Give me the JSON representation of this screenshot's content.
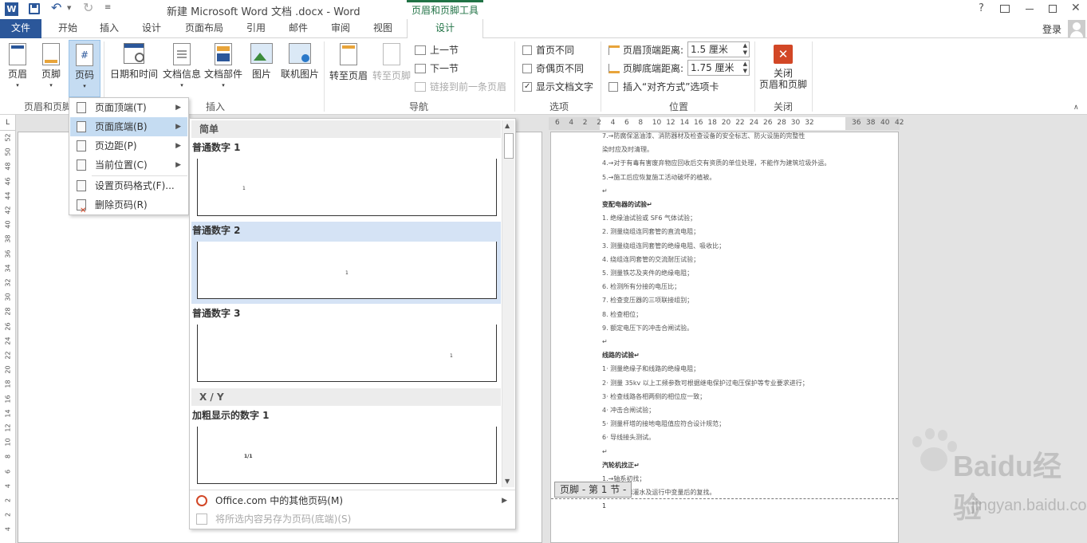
{
  "window": {
    "title": "新建 Microsoft Word 文档 .docx - Word",
    "context_tab": "页眉和页脚工具",
    "help": "?",
    "signin": "登录"
  },
  "tabs": [
    "文件",
    "开始",
    "插入",
    "设计",
    "页面布局",
    "引用",
    "邮件",
    "审阅",
    "视图",
    "设计"
  ],
  "ribbon": {
    "hf_group": {
      "header": "页眉",
      "footer": "页脚",
      "pagenum": "页码",
      "label": "页眉和页脚"
    },
    "insert_group": {
      "datetime": "日期和时间",
      "docinfo": "文档信息",
      "parts": "文档部件",
      "picture": "图片",
      "online": "联机图片",
      "label": "插入"
    },
    "nav_group": {
      "goto_header": "转至页眉",
      "goto_footer": "转至页脚",
      "prev": "上一节",
      "next": "下一节",
      "link": "链接到前一条页眉",
      "label": "导航"
    },
    "options_group": {
      "first": "首页不同",
      "oddeven": "奇偶页不同",
      "showtext": "显示文档文字",
      "label": "选项"
    },
    "position_group": {
      "header_dist_label": "页眉顶端距离:",
      "header_dist": "1.5 厘米",
      "footer_dist_label": "页脚底端距离:",
      "footer_dist": "1.75 厘米",
      "align_tab": "插入“对齐方式”选项卡",
      "label": "位置"
    },
    "close_group": {
      "close_l1": "关闭",
      "close_l2": "页眉和页脚",
      "label": "关闭"
    }
  },
  "menu": {
    "items": [
      "页面顶端(T)",
      "页面底端(B)",
      "页边距(P)",
      "当前位置(C)",
      "设置页码格式(F)...",
      "删除页码(R)"
    ]
  },
  "gallery": {
    "section1": "简单",
    "items": [
      {
        "title": "普通数字 1",
        "mark": "1"
      },
      {
        "title": "普通数字 2",
        "mark": "1"
      },
      {
        "title": "普通数字 3",
        "mark": "1"
      }
    ],
    "section2": "X / Y",
    "bold_item": {
      "title": "加粗显示的数字 1",
      "mark": "1/1"
    },
    "more": "Office.com 中的其他页码(M)",
    "save": "将所选内容另存为页码(底端)(S)"
  },
  "hruler": [
    "6",
    "4",
    "2",
    "2",
    "4",
    "6",
    "8",
    "10",
    "12",
    "14",
    "16",
    "18",
    "20",
    "22",
    "24",
    "26",
    "28",
    "30",
    "32",
    "36",
    "38",
    "40",
    "42"
  ],
  "vruler": [
    "52",
    "50",
    "48",
    "46",
    "44",
    "42",
    "40",
    "38",
    "36",
    "34",
    "32",
    "30",
    "28",
    "26",
    "24",
    "22",
    "20",
    "18",
    "16",
    "14",
    "12",
    "10",
    "8",
    "6",
    "4",
    "2",
    "2",
    "4"
  ],
  "doc": {
    "lines": [
      "7.→防腐保温油漆、消防器材及检查设备的安全标志、防火设施的完整性",
      "   染时应及时清理。",
      "4.→对于有毒有害废弃物应回收后交有资质的单位处理，不能作为建筑垃圾外运。",
      "5.→施工后应恢复施工活动破坏的植被。",
      "↵",
      "变配电器的试验↵",
      "1. 绝缘油试验或 SF6 气体试验；",
      "2. 测量绕组连同套管的直流电阻；",
      "3. 测量绕组连同套管的绝缘电阻、吸收比；",
      "4. 绕组连同套管的交流耐压试验；",
      "5. 测量铁芯及夹件的绝缘电阻；",
      "6. 检测所有分接的电压比；",
      "7. 检查变压器的三项联接组别；",
      "8. 检查相位；",
      "9. 额定电压下的冲击合闸试验。",
      "↵",
      "线路的试验↵",
      "1· 测量绝缘子和线路的绝缘电阻；",
      "2· 测量 35kv 以上工频参数可根据继电保护过电压保护等专业要求进行；",
      "3· 检查线路各相两侧的相位应一致；",
      "4· 冲击合闸试验；",
      "5· 测量杆塔的接地电阻值应符合设计规范；",
      "6· 导线接头测试。",
      "↵",
      "汽轮机找正↵",
      "1.→轴系初找；",
      "2.→凝汽器灌水及运行中变量后的复找。"
    ],
    "bold_idx": [
      5,
      16,
      24
    ],
    "footer_tag": "页脚 - 第 1 节 -",
    "footer_mark": "1"
  },
  "watermark": {
    "brand": "Baidu经验",
    "url": "jingyan.baidu.com"
  },
  "colors": {
    "accent": "#2b579a",
    "context": "#217346",
    "close": "#d24726"
  }
}
